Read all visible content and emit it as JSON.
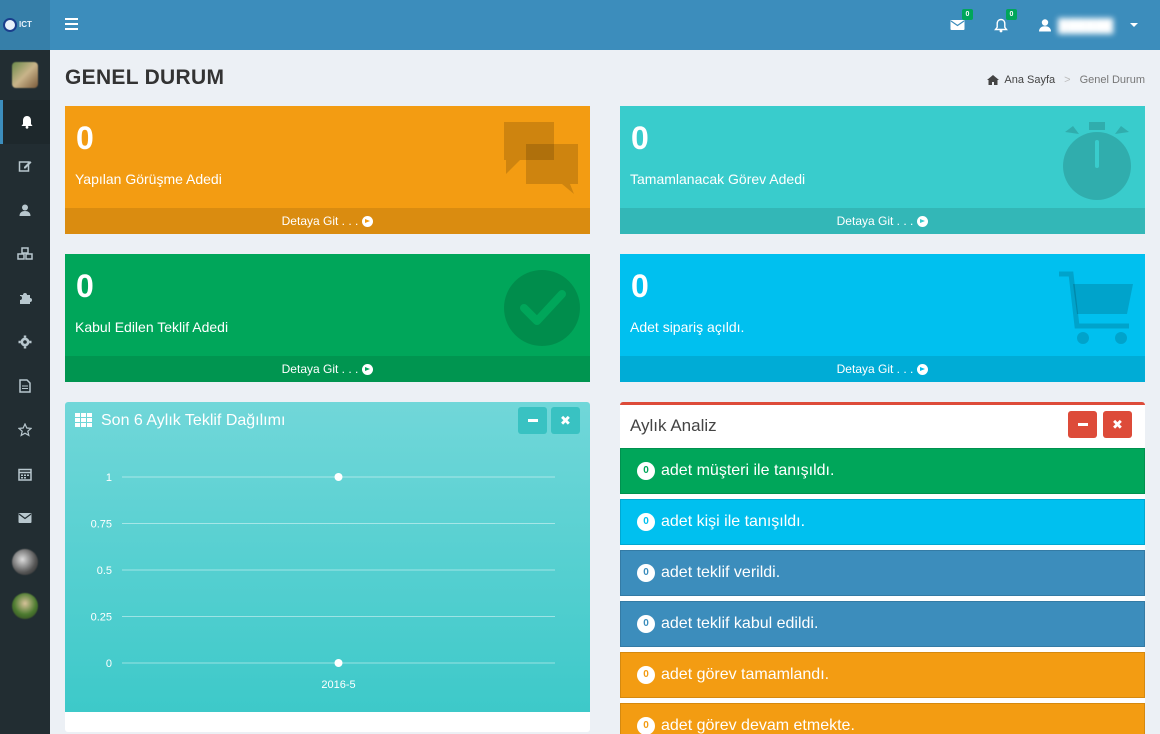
{
  "app": {
    "logo_text": "ICT",
    "badges": {
      "messages": "0",
      "notifications": "0"
    }
  },
  "colors": {
    "header": "#3c8dbc",
    "sidebar": "#222d32",
    "orange": "#f39c12",
    "teal": "#39cccc",
    "green": "#00a65a",
    "aqua": "#00c0ef",
    "blue": "#3c8dbc",
    "red": "#dd4b39"
  },
  "page": {
    "title": "GENEL DURUM",
    "breadcrumb": {
      "home": "Ana Sayfa",
      "current": "Genel Durum"
    }
  },
  "boxes": [
    {
      "count": "0",
      "label": "Yapılan Görüşme Adedi",
      "footer": "Detaya Git . . .",
      "icon": "comments-icon"
    },
    {
      "count": "0",
      "label": "Tamamlanacak Görev Adedi",
      "footer": "Detaya Git . . .",
      "icon": "stopwatch-icon"
    },
    {
      "count": "0",
      "label": "Kabul Edilen Teklif Adedi",
      "footer": "Detaya Git . . .",
      "icon": "check-circle-icon"
    },
    {
      "count": "0",
      "label": "Adet sipariş açıldı.",
      "footer": "Detaya Git . . .",
      "icon": "shopping-cart-icon"
    }
  ],
  "chart_panel": {
    "title": "Son 6 Aylık Teklif Dağılımı"
  },
  "chart_data": {
    "type": "line",
    "title": "Son 6 Aylık Teklif Dağılımı",
    "categories": [
      "2016-5"
    ],
    "series": [
      {
        "values": [
          1
        ]
      },
      {
        "values": [
          0
        ]
      }
    ],
    "ylim": [
      0,
      1
    ],
    "yticks": [
      "1",
      "0.75",
      "0.5",
      "0.25",
      "0"
    ],
    "grid": true
  },
  "analiz": {
    "title": "Aylık Analiz",
    "items": [
      {
        "count": "0",
        "text": "adet müşteri ile tanışıldı."
      },
      {
        "count": "0",
        "text": "adet kişi ile tanışıldı."
      },
      {
        "count": "0",
        "text": "adet teklif verildi."
      },
      {
        "count": "0",
        "text": "adet teklif kabul edildi."
      },
      {
        "count": "0",
        "text": "adet görev tamamlandı."
      },
      {
        "count": "0",
        "text": "adet görev devam etmekte."
      }
    ]
  }
}
